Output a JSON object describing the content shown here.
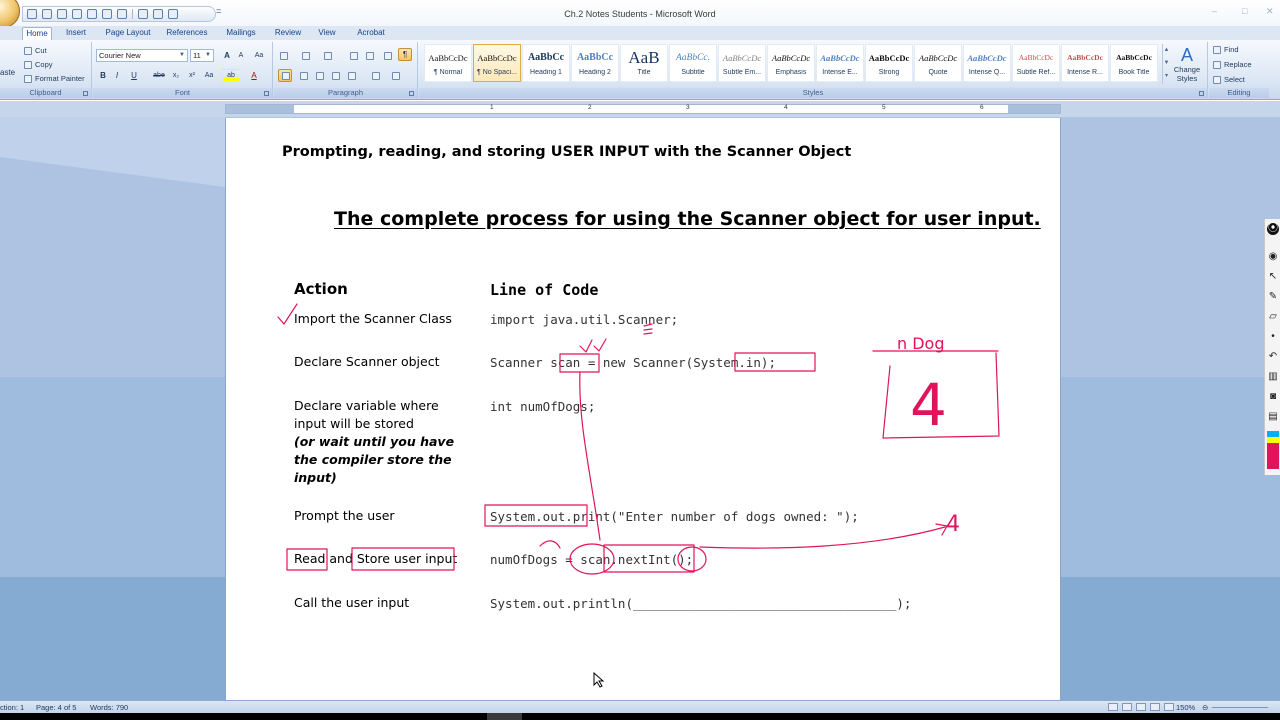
{
  "window": {
    "title": "Ch.2 Notes Students - Microsoft Word",
    "minimize": "–",
    "maximize": "□",
    "close": "✕",
    "qat_more": "="
  },
  "ribbon_tabs": [
    "Home",
    "Insert",
    "Page Layout",
    "References",
    "Mailings",
    "Review",
    "View",
    "Acrobat"
  ],
  "clipboard": {
    "paste_label": "aste",
    "cut": "Cut",
    "copy": "Copy",
    "format_painter": "Format Painter",
    "group_label": "Clipboard"
  },
  "font": {
    "font_name": "Courier New",
    "font_size": "11",
    "grow": "A",
    "shrink": "A",
    "clear": "Aa",
    "bold": "B",
    "italic": "I",
    "underline": "U",
    "strike": "abe",
    "subscript": "x₂",
    "superscript": "x²",
    "change_case": "Aa",
    "highlight": "ab",
    "font_color": "A",
    "group_label": "Font"
  },
  "paragraph": {
    "group_label": "Paragraph",
    "show_marks": "¶"
  },
  "styles": {
    "group_label": "Styles",
    "items": [
      {
        "sample": "AaBbCcDc",
        "name": "¶ Normal"
      },
      {
        "sample": "AaBbCcDc",
        "name": "¶ No Spaci..."
      },
      {
        "sample": "AaBbCc",
        "name": "Heading 1"
      },
      {
        "sample": "AaBbCc",
        "name": "Heading 2"
      },
      {
        "sample": "AaB",
        "name": "Title"
      },
      {
        "sample": "AaBbCc.",
        "name": "Subtitle"
      },
      {
        "sample": "AaBbCcDc",
        "name": "Subtle Em..."
      },
      {
        "sample": "AaBbCcDc",
        "name": "Emphasis"
      },
      {
        "sample": "AaBbCcDc",
        "name": "Intense E..."
      },
      {
        "sample": "AaBbCcDc",
        "name": "Strong"
      },
      {
        "sample": "AaBbCcDc",
        "name": "Quote"
      },
      {
        "sample": "AaBbCcDc",
        "name": "Intense Q..."
      },
      {
        "sample": "AaBbCcDc",
        "name": "Subtle Ref..."
      },
      {
        "sample": "AaBbCcDc",
        "name": "Intense R..."
      },
      {
        "sample": "AaBbCcDc",
        "name": "Book Title"
      }
    ],
    "change_styles": "Change Styles"
  },
  "editing": {
    "find": "Find",
    "replace": "Replace",
    "select": "Select",
    "group_label": "Editing"
  },
  "ruler_numbers": [
    "1",
    "2",
    "3",
    "4",
    "5",
    "6",
    "7"
  ],
  "document": {
    "heading": "Prompting, reading, and storing USER INPUT with the Scanner Object",
    "title": "The complete process for using the Scanner object for user input.",
    "col_action": "Action",
    "col_code": "Line of Code",
    "rows": [
      {
        "action": "Import the Scanner Class",
        "code": "import java.util.Scanner;"
      },
      {
        "action": "Declare Scanner object",
        "code": "Scanner scan = new Scanner(System.in);"
      },
      {
        "action_lines": [
          "Declare variable where",
          "input will be stored"
        ],
        "note_lines": [
          "(or wait until you have",
          "the compiler store the",
          "input)"
        ],
        "code": "int numOfDogs;"
      },
      {
        "action": "Prompt the user",
        "code": "System.out.print(\"Enter number of dogs owned: \");"
      },
      {
        "action": "Read and Store user input",
        "code": "numOfDogs = scan.nextInt();"
      },
      {
        "action": "Call the user input",
        "code": "System.out.println(___________________________________);"
      }
    ]
  },
  "annotations": {
    "box_label": "n Dog",
    "box_value": "4",
    "arrow_value": "4"
  },
  "statusbar": {
    "section": "ction: 1",
    "page": "Page: 4 of 5",
    "words": "Words: 790",
    "zoom": "150%"
  },
  "colors": {
    "ink": "#e0145a",
    "ribbon": "#dbe6f4",
    "doc_background": "#aec3e1"
  }
}
